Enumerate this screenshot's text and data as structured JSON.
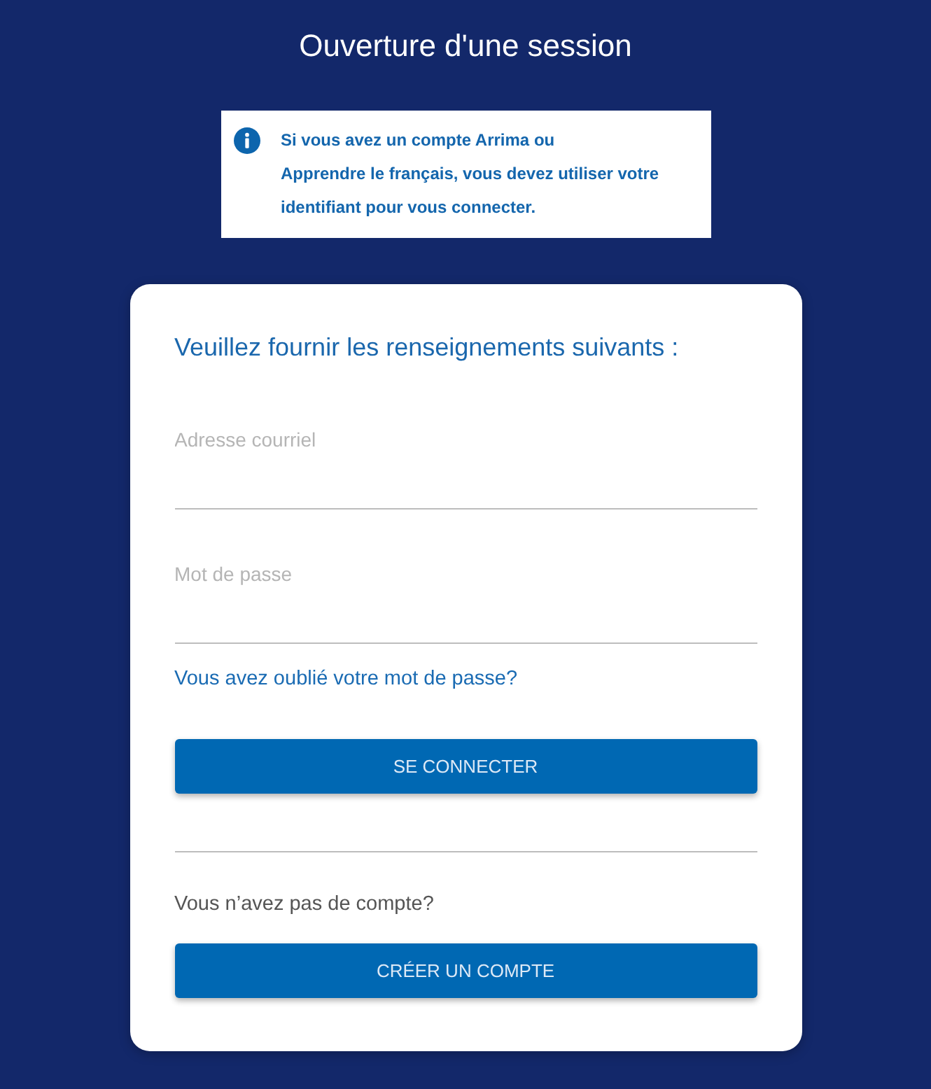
{
  "title": "Ouverture d'une session",
  "notice": {
    "text": "Si vous avez un compte Arrima ou\nApprendre le français, vous devez utiliser votre identifiant pour vous connecter."
  },
  "form": {
    "heading": "Veuillez fournir les renseignements suivants :",
    "fields": [
      {
        "placeholder": "Adresse courriel"
      },
      {
        "placeholder": "Mot de passe"
      }
    ],
    "forgot_link": "Vous avez oublié votre mot de passe?",
    "submit_button": "SE CONNECTER",
    "signup_prompt": "Vous n’avez pas de compte?",
    "signup_button": "CRÉER UN COMPTE"
  }
}
